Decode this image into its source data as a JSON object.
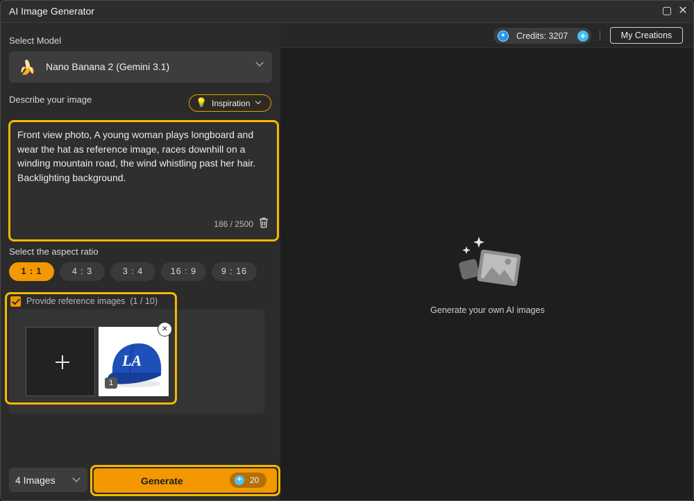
{
  "window": {
    "title": "AI Image Generator"
  },
  "model": {
    "label": "Select Model",
    "selected": "Nano Banana 2 (Gemini 3.1)",
    "icon": "banana-icon"
  },
  "describe": {
    "label": "Describe your image",
    "inspiration_label": "Inspiration",
    "prompt": "Front view photo, A young woman plays longboard and wear the hat as reference image, races downhill on a winding mountain road, the wind whistling past her hair. Backlighting background.",
    "counter": "186 / 2500"
  },
  "aspect": {
    "label": "Select the aspect ratio",
    "options": [
      "1 : 1",
      "4 : 3",
      "3 : 4",
      "16 : 9",
      "9 : 16"
    ],
    "selected": "1 : 1"
  },
  "reference": {
    "label": "Provide reference images",
    "count": "(1 / 10)",
    "checked": true,
    "tile_number": "1"
  },
  "footer": {
    "images_count": "4 Images",
    "generate_label": "Generate",
    "generate_cost": "20"
  },
  "topbar": {
    "credits": "Credits: 3207",
    "my_creations": "My Creations"
  },
  "empty_state": {
    "text": "Generate your own AI images"
  },
  "colors": {
    "accent": "#f39800",
    "highlight": "#f5b800",
    "credit_blue": "#3fc0f5"
  }
}
